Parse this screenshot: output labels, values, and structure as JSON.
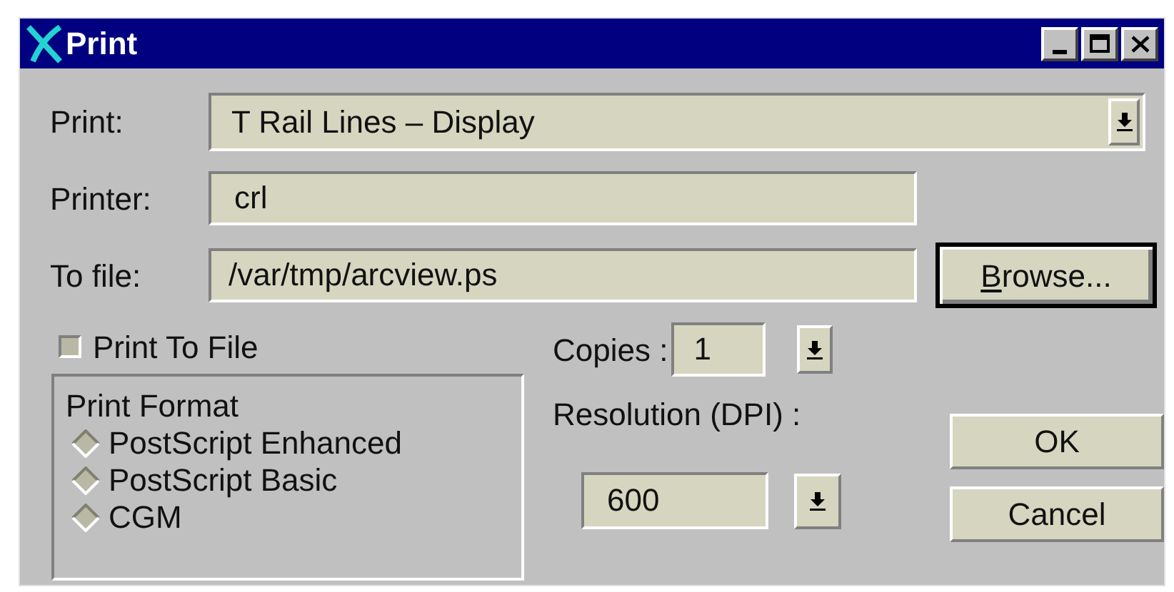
{
  "window": {
    "title": "Print"
  },
  "print": {
    "label": "Print:",
    "value": "T Rail Lines – Display"
  },
  "printer": {
    "label": "Printer:",
    "value": "crl"
  },
  "to_file": {
    "label": "To file:",
    "value": "/var/tmp/arcview.ps"
  },
  "browse_button": {
    "label": "Browse...",
    "first_letter_underlined": true
  },
  "print_to_file": {
    "label": "Print To File",
    "checked": false
  },
  "print_format": {
    "title": "Print Format",
    "options": [
      {
        "label": "PostScript Enhanced",
        "selected": false
      },
      {
        "label": "PostScript Basic",
        "selected": false
      },
      {
        "label": "CGM",
        "selected": false
      }
    ]
  },
  "copies": {
    "label": "Copies :",
    "value": "1"
  },
  "resolution": {
    "label": "Resolution (DPI) :",
    "value": "600"
  },
  "buttons": [
    {
      "label": "OK"
    },
    {
      "label": "Cancel"
    }
  ]
}
